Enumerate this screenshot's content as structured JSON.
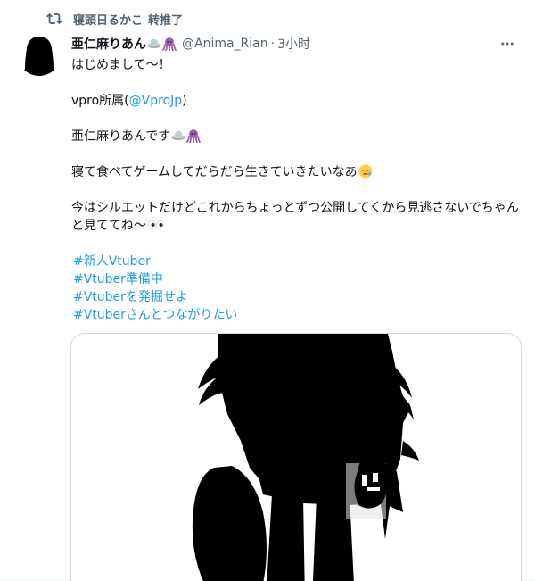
{
  "retweet": {
    "user": "寝頭日るかこ",
    "action": "转推了",
    "icon": "retweet-icon"
  },
  "author": {
    "display_name": "亜仁麻りあん",
    "name_emojis": [
      "ufo-emoji",
      "octopus-emoji"
    ],
    "handle": "@Anima_Rian",
    "separator": "·",
    "time": "3小时"
  },
  "tweet": {
    "line1": "はじめまして〜！",
    "affiliation_prefix": "vpro所属(",
    "mention": "@VproJp",
    "affiliation_suffix": ")",
    "name_line": "亜仁麻りあんです",
    "line3": "寝て食べてゲームしてだらだら生きていきたいなあ",
    "line4": "今はシルエットだけどこれからちょっとずつ公開してくから見逃さないでちゃんと見ててね〜",
    "hashtags": [
      "#新人Vtuber",
      "#Vtuber準備中",
      "#Vtuberを発掘せよ",
      "#Vtuberさんとつながりたい"
    ]
  },
  "colors": {
    "accent": "#1d9bf0",
    "text": "#0f1419",
    "secondary": "#536471"
  },
  "icons": {
    "more": "more-icon",
    "sad": "sad-face-emoji",
    "eyes": "eyes-emoji"
  }
}
